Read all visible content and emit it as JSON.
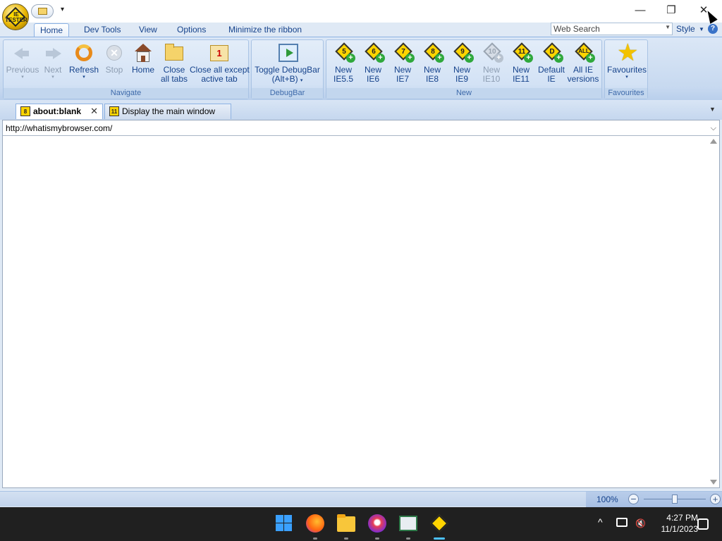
{
  "titlebar": {
    "window_controls": [
      "minimize",
      "restore",
      "close"
    ]
  },
  "ribbon_tabs": [
    {
      "label": "Home",
      "active": true
    },
    {
      "label": "Dev Tools",
      "active": false
    },
    {
      "label": "View",
      "active": false
    },
    {
      "label": "Options",
      "active": false
    },
    {
      "label": "Minimize the ribbon",
      "active": false
    }
  ],
  "search": {
    "placeholder": "Web Search"
  },
  "style_menu": {
    "label": "Style"
  },
  "groups": {
    "navigate": {
      "label": "Navigate",
      "buttons": [
        {
          "label": "Previous",
          "enabled": false,
          "icon": "back-arrow-icon"
        },
        {
          "label": "Next",
          "enabled": false,
          "icon": "forward-arrow-icon"
        },
        {
          "label": "Refresh",
          "enabled": true,
          "icon": "refresh-icon"
        },
        {
          "label": "Stop",
          "enabled": false,
          "icon": "stop-icon"
        },
        {
          "label": "Home",
          "enabled": true,
          "icon": "home-icon"
        },
        {
          "label1": "Close",
          "label2": "all tabs",
          "enabled": true,
          "icon": "folder-icon"
        },
        {
          "label1": "Close all except",
          "label2": "active tab",
          "enabled": true,
          "icon": "close-except-icon",
          "badge": "1"
        }
      ]
    },
    "debugbar": {
      "label": "DebugBar",
      "button": {
        "label1": "Toggle DebugBar",
        "label2": "(Alt+B)"
      }
    },
    "new": {
      "label": "New",
      "buttons": [
        {
          "num": "5",
          "label1": "New",
          "label2": "IE5.5",
          "enabled": true
        },
        {
          "num": "6",
          "label1": "New",
          "label2": "IE6",
          "enabled": true
        },
        {
          "num": "7",
          "label1": "New",
          "label2": "IE7",
          "enabled": true
        },
        {
          "num": "8",
          "label1": "New",
          "label2": "IE8",
          "enabled": true
        },
        {
          "num": "9",
          "label1": "New",
          "label2": "IE9",
          "enabled": true
        },
        {
          "num": "10",
          "label1": "New",
          "label2": "IE10",
          "enabled": false
        },
        {
          "num": "11",
          "label1": "New",
          "label2": "IE11",
          "enabled": true
        },
        {
          "num": "D",
          "label1": "Default",
          "label2": "IE",
          "enabled": true
        },
        {
          "num": "ALL",
          "label1": "All IE",
          "label2": "versions",
          "enabled": true
        }
      ]
    },
    "favourites": {
      "label": "Favourites",
      "button": {
        "label": "Favourites",
        "icon": "star-icon"
      }
    }
  },
  "doc_tabs": [
    {
      "icon_num": "8",
      "label": "about:blank",
      "active": true
    },
    {
      "icon_num": "11",
      "label": "Display the main window in...",
      "active": false
    }
  ],
  "address": {
    "url": "http://whatismybrowser.com/"
  },
  "status": {
    "zoom": "100%",
    "zoom_level": 0.5
  },
  "taskbar": {
    "apps": [
      "start-icon",
      "firefox-icon",
      "file-explorer-icon",
      "firefox-developer-icon",
      "notepad-icon",
      "ietester-icon"
    ],
    "time": "4:27 PM",
    "date": "11/1/2023"
  },
  "colors": {
    "ribbon_bg": "#c7d9f0",
    "taskbar_bg": "#202020",
    "accent": "#4cc2ff"
  }
}
